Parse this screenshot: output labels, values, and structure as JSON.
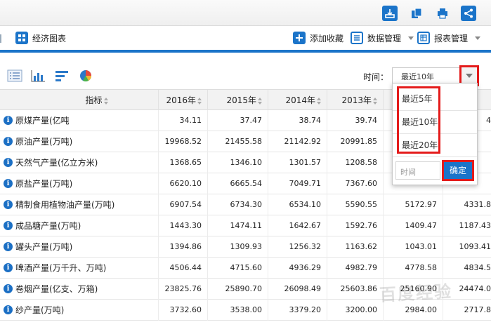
{
  "toolbar_top": {
    "icons": [
      "download-icon",
      "copy-icon",
      "print-icon",
      "share-icon"
    ],
    "accent": "#1b74c9"
  },
  "menu": {
    "chart_label": "经济图表",
    "favorite_label": "添加收藏",
    "data_mgmt_label": "数据管理",
    "report_mgmt_label": "报表管理"
  },
  "filter": {
    "view_icons": [
      "list-view-icon",
      "bar-chart-icon",
      "horizontal-bar-icon",
      "pie-chart-icon"
    ],
    "time_label": "时间：",
    "time_selected": "最近10年"
  },
  "dropdown": {
    "options": [
      "最近5年",
      "最近10年",
      "最近20年"
    ],
    "custom_placeholder": "时间",
    "confirm_label": "确定",
    "highlight_color": "#e41b1b"
  },
  "table": {
    "headers": [
      "指标",
      "2016年",
      "2015年",
      "2014年",
      "2013年",
      "",
      ""
    ],
    "rows": [
      {
        "name": "原煤产量(亿吨",
        "values": [
          "34.11",
          "37.47",
          "38.74",
          "39.74",
          "",
          "4"
        ]
      },
      {
        "name": "原油产量(万吨)",
        "values": [
          "19968.52",
          "21455.58",
          "21142.92",
          "20991.85",
          "",
          ""
        ]
      },
      {
        "name": "天然气产量(亿立方米)",
        "values": [
          "1368.65",
          "1346.10",
          "1301.57",
          "1208.58",
          "",
          ""
        ]
      },
      {
        "name": "原盐产量(万吨)",
        "values": [
          "6620.10",
          "6665.54",
          "7049.71",
          "7367.60",
          "",
          ""
        ]
      },
      {
        "name": "精制食用植物油产量(万吨)",
        "values": [
          "6907.54",
          "6734.30",
          "6534.10",
          "5590.55",
          "5172.97",
          "4331.8"
        ]
      },
      {
        "name": "成品糖产量(万吨)",
        "values": [
          "1443.30",
          "1474.11",
          "1642.67",
          "1592.76",
          "1409.47",
          "1187.43"
        ]
      },
      {
        "name": "罐头产量(万吨)",
        "values": [
          "1394.86",
          "1309.93",
          "1256.32",
          "1163.62",
          "1043.01",
          "1093.41"
        ]
      },
      {
        "name": "啤酒产量(万千升、万吨)",
        "values": [
          "4506.44",
          "4715.60",
          "4936.29",
          "4982.79",
          "4778.58",
          "4834.5"
        ]
      },
      {
        "name": "卷烟产量(亿支、万箱)",
        "values": [
          "23825.76",
          "25890.70",
          "26098.49",
          "25603.86",
          "25160.90",
          "24474.0"
        ]
      },
      {
        "name": "纱产量(万吨)",
        "values": [
          "3732.60",
          "3538.00",
          "3379.20",
          "3200.00",
          "2984.00",
          "2717.8"
        ]
      }
    ]
  },
  "watermark": "百度经验"
}
